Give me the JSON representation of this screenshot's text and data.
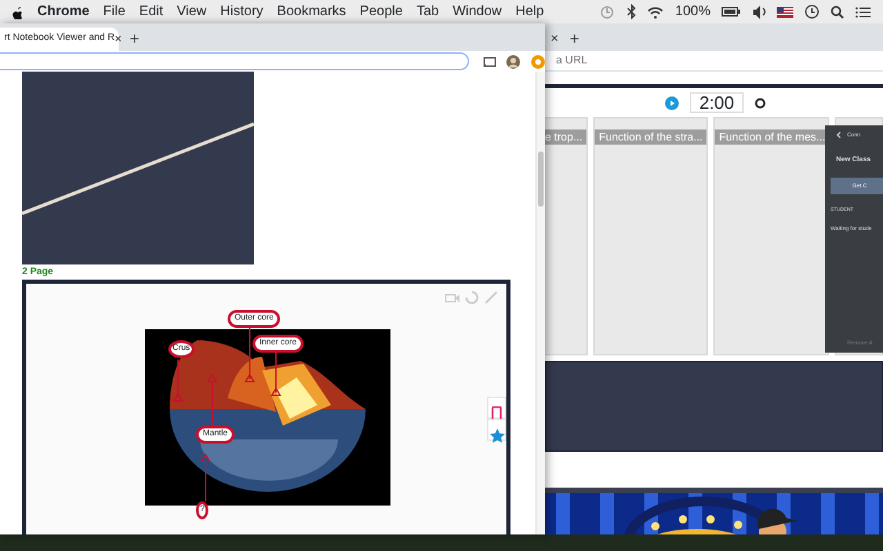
{
  "menu_bar": {
    "items": [
      {
        "label": "Chrome",
        "bold": true
      },
      {
        "label": "File",
        "bold": false
      },
      {
        "label": "Edit",
        "bold": false
      },
      {
        "label": "View",
        "bold": false
      },
      {
        "label": "History",
        "bold": false
      },
      {
        "label": "Bookmarks",
        "bold": false
      },
      {
        "label": "People",
        "bold": false
      },
      {
        "label": "Tab",
        "bold": false
      },
      {
        "label": "Window",
        "bold": false
      },
      {
        "label": "Help",
        "bold": false
      }
    ],
    "battery": "100%"
  },
  "front_window": {
    "tab": {
      "title": "rt Notebook Viewer and R",
      "close": "×"
    },
    "new_tab": "+",
    "page_label": "2 Page",
    "hotspots": [
      {
        "label": "Outer core",
        "round": false
      },
      {
        "label": "Inner core",
        "round": false
      },
      {
        "label": "Crus",
        "round": true
      },
      {
        "label": "Mantle",
        "round": false
      },
      {
        "label": "?",
        "round": true
      }
    ]
  },
  "back_window": {
    "tab_close": "×",
    "new_tab": "+",
    "address_placeholder": "a URL",
    "timer": "2:00",
    "columns": [
      {
        "title": "e trop..."
      },
      {
        "title": "Function of the stra..."
      },
      {
        "title": "Function of the mes..."
      }
    ],
    "panel": {
      "title": "Conn",
      "heading": "New Class",
      "button": "Get C",
      "section": "STUDENT",
      "status": "Waiting for stude",
      "footer": "Remove A"
    }
  }
}
